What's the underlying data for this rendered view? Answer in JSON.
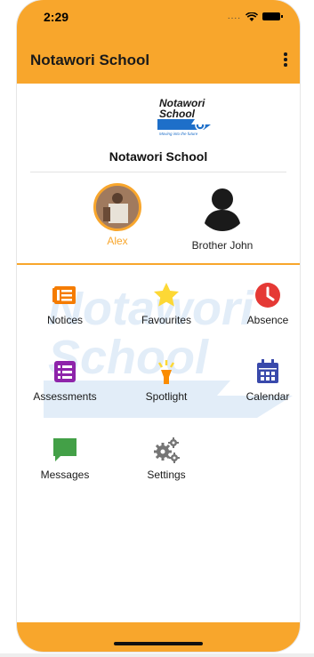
{
  "status_bar": {
    "time": "2:29",
    "signal": "....",
    "icons": [
      "wifi-icon",
      "battery-icon"
    ]
  },
  "app_bar": {
    "title": "Notawori School",
    "menu_icon": "more-vert-icon"
  },
  "logo": {
    "line1": "Notawori",
    "line2": "School",
    "tagline": "Moving into the future"
  },
  "school": {
    "name": "Notawori School"
  },
  "profiles": [
    {
      "name": "Alex",
      "selected": true
    },
    {
      "name": "Brother John",
      "selected": false
    }
  ],
  "menu": [
    {
      "label": "Notices",
      "icon": "notices-icon",
      "color": "#F57C00"
    },
    {
      "label": "Favourites",
      "icon": "star-icon",
      "color": "#FDD835"
    },
    {
      "label": "Absence",
      "icon": "clock-icon",
      "color": "#E53935"
    },
    {
      "label": "Assessments",
      "icon": "list-icon",
      "color": "#8E24AA"
    },
    {
      "label": "Spotlight",
      "icon": "spotlight-icon",
      "color": "#FB8C00"
    },
    {
      "label": "Calendar",
      "icon": "calendar-icon",
      "color": "#3949AB"
    },
    {
      "label": "Messages",
      "icon": "chat-icon",
      "color": "#43A047"
    },
    {
      "label": "Settings",
      "icon": "gears-icon",
      "color": "#757575"
    }
  ],
  "colors": {
    "accent": "#F8A62C"
  }
}
